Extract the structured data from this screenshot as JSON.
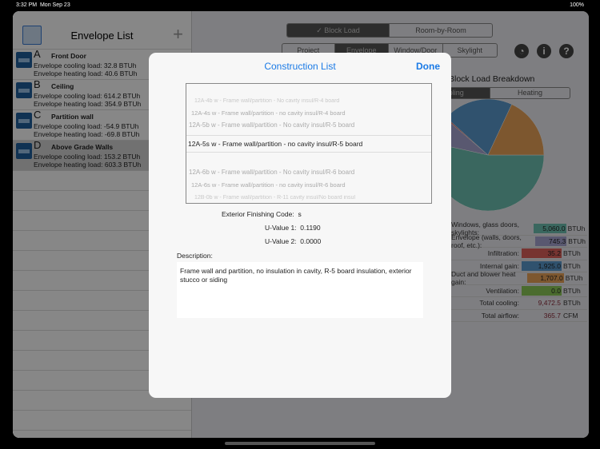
{
  "status": {
    "time": "3:32 PM",
    "date": "Mon Sep 23",
    "battery": "100%"
  },
  "sidebar": {
    "title": "Envelope List",
    "add": "+",
    "items": [
      {
        "letter": "A",
        "name": "Front Door",
        "cooling": "Envelope cooling load: 32.8 BTUh",
        "heating": "Envelope heating load: 40.6 BTUh"
      },
      {
        "letter": "B",
        "name": "Ceiling",
        "cooling": "Envelope cooling load: 614.2 BTUh",
        "heating": "Envelope heating load: 354.9 BTUh"
      },
      {
        "letter": "C",
        "name": "Partition wall",
        "cooling": "Envelope cooling load: -54.9 BTUh",
        "heating": "Envelope heating load: -69.8 BTUh"
      },
      {
        "letter": "D",
        "name": "Above Grade Walls",
        "cooling": "Envelope cooling load: 153.2 BTUh",
        "heating": "Envelope heating load: 603.3 BTUh",
        "selected": true
      }
    ]
  },
  "mode_tabs": [
    "✓ Block Load",
    "Room-by-Room"
  ],
  "section_tabs": [
    "Project",
    "Envelope",
    "Window/Door",
    "Skylight"
  ],
  "breakdown": {
    "title": "Block Load Breakdown",
    "tabs": [
      "Cooling",
      "Heating"
    ],
    "rows": [
      {
        "label": "Windows, glass doors, skylights:",
        "value": "5,060.0",
        "unit": "BTUh",
        "color": "#6fc3b4"
      },
      {
        "label": "Envelope (walls, doors, roof, etc.):",
        "value": "745.3",
        "unit": "BTUh",
        "color": "#a9a6d3"
      },
      {
        "label": "Infiltration:",
        "value": "35.2",
        "unit": "BTUh",
        "color": "#e0625e"
      },
      {
        "label": "Internal gain:",
        "value": "1,925.0",
        "unit": "BTUh",
        "color": "#5b9bd0"
      },
      {
        "label": "Duct and blower heat gain:",
        "value": "1,707.0",
        "unit": "BTUh",
        "color": "#eda45a"
      },
      {
        "label": "Ventilation:",
        "value": "0.0",
        "unit": "BTUh",
        "color": "#8fcc5a"
      },
      {
        "label": "Total cooling:",
        "value": "9,472.5",
        "unit": "BTUh"
      },
      {
        "label": "Total airflow:",
        "value": "365.7",
        "unit": "CFM"
      }
    ]
  },
  "modal": {
    "title": "Construction List",
    "done": "Done",
    "options": [
      "12A-4b w - Frame wall/partition - No cavity insul/R-4 board",
      "12A-4s w - Frame wall/partition - no cavity insul/R-4 board",
      "12A-5b w - Frame wall/partition - No cavity insul/R-5 board",
      "12A-5s w - Frame wall/partition - no cavity insul/R-5 board",
      "12A-6b w - Frame wall/partition - No cavity insul/R-6 board",
      "12A-6s w - Frame wall/partition - no cavity insul/R-6 board",
      "12B-0b w - Frame wall/partition - R-11 cavity insul/No board insul"
    ],
    "finishing_label": "Exterior Finishing Code:",
    "finishing": "s",
    "u1_label": "U-Value 1:",
    "u1": "0.1190",
    "u2_label": "U-Value 2:",
    "u2": "0.0000",
    "desc_label": "Description:",
    "description": "Frame wall and partition, no insulation in cavity, R-5 board insulation, exterior stucco or siding"
  }
}
